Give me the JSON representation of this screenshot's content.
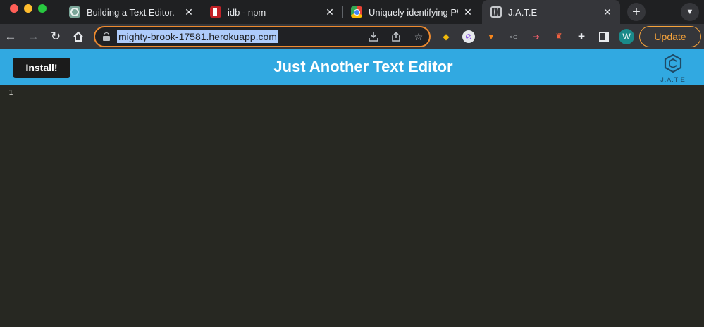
{
  "browser": {
    "tabs": [
      {
        "title": "Building a Text Editor.",
        "icon": "openai-icon",
        "active": false
      },
      {
        "title": "idb - npm",
        "icon": "npm-icon",
        "active": false
      },
      {
        "title": "Uniquely identifying PW",
        "icon": "chrome-icon",
        "active": false
      },
      {
        "title": "J.A.T.E",
        "icon": "globe-icon",
        "active": true
      }
    ],
    "address_bar": {
      "url": "mighty-brook-17581.herokuapp.com"
    },
    "profile_initial": "W",
    "update_label": "Update",
    "new_tab_glyph": "+",
    "tab_close_glyph": "✕"
  },
  "app": {
    "install_label": "Install!",
    "title": "Just Another Text Editor",
    "logo_text": "J.A.T.E",
    "accent_color": "#31a9e1"
  },
  "editor": {
    "line_numbers": [
      "1"
    ],
    "content": "",
    "background": "#272822"
  }
}
